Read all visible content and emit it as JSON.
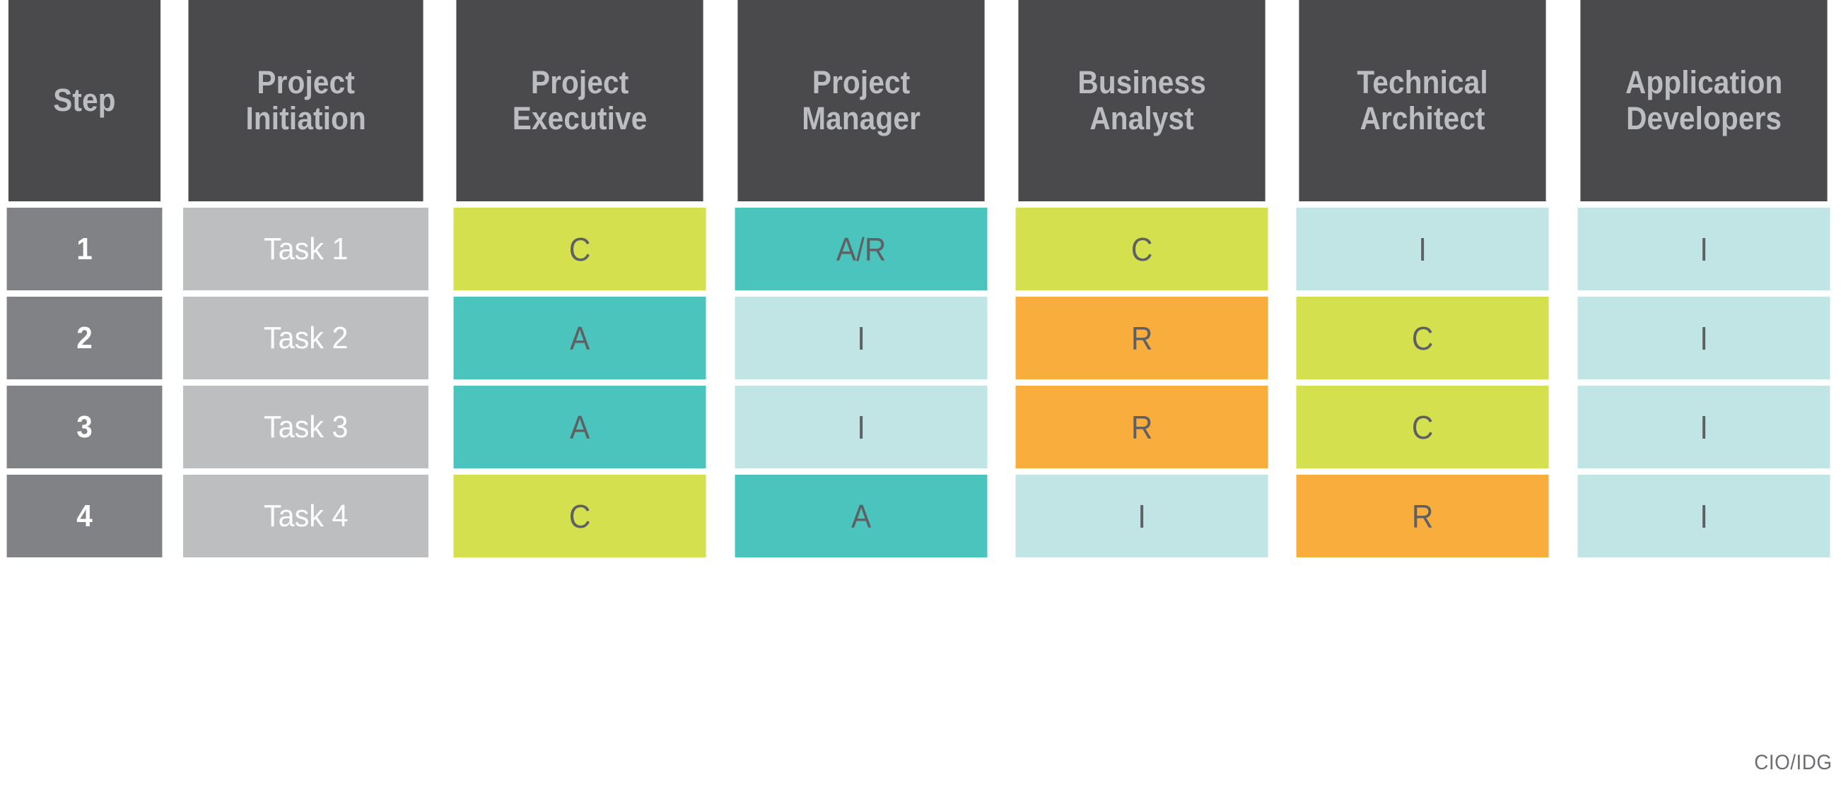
{
  "table": {
    "columns": [
      {
        "id": "step",
        "label_lines": [
          "Step"
        ]
      },
      {
        "id": "task",
        "label_lines": [
          "Project",
          "Initiation"
        ]
      },
      {
        "id": "exec",
        "label_lines": [
          "Project",
          "Executive"
        ]
      },
      {
        "id": "pm",
        "label_lines": [
          "Project",
          "Manager"
        ]
      },
      {
        "id": "ba",
        "label_lines": [
          "Business",
          "Analyst"
        ]
      },
      {
        "id": "ta",
        "label_lines": [
          "Technical",
          "Architect"
        ]
      },
      {
        "id": "dev",
        "label_lines": [
          "Application",
          "Developers"
        ]
      }
    ],
    "rows": [
      {
        "step": "1",
        "task": "Task 1",
        "values": [
          "C",
          "A/R",
          "C",
          "I",
          "I"
        ]
      },
      {
        "step": "2",
        "task": "Task 2",
        "values": [
          "A",
          "I",
          "R",
          "C",
          "I"
        ]
      },
      {
        "step": "3",
        "task": "Task 3",
        "values": [
          "A",
          "I",
          "R",
          "C",
          "I"
        ]
      },
      {
        "step": "4",
        "task": "Task 4",
        "values": [
          "C",
          "A",
          "I",
          "R",
          "I"
        ]
      }
    ]
  },
  "credit": "CIO/IDG",
  "colors": {
    "header_bg": "#4a4a4d",
    "header_text": "#bcbdc0",
    "step_bg": "#808285",
    "task_bg": "#bcbec0",
    "cell_text": "#5e6063",
    "consulted_C": "#d4e04d",
    "accountable_A": "#4ac4bd",
    "responsible_R": "#f9ad3c",
    "informed_I": "#c1e5e5",
    "page_bg": "#ffffff"
  }
}
